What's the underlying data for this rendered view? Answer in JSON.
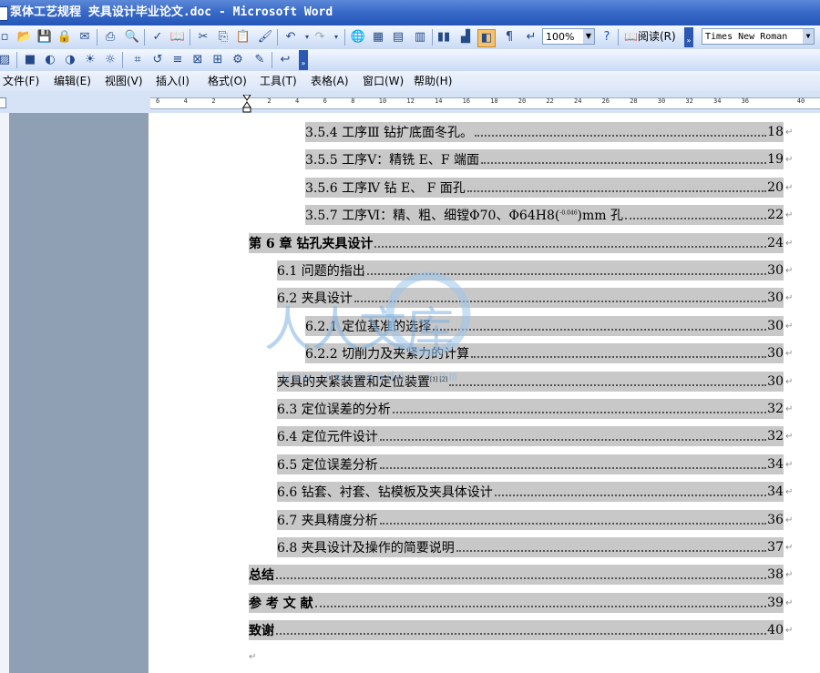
{
  "window": {
    "title": "泵体工艺规程 夹具设计毕业论文.doc - Microsoft Word"
  },
  "toolbar": {
    "zoom": "100%",
    "read_label": "阅读(R)",
    "font_name": "Times New Roman"
  },
  "menu": [
    {
      "label": "文件(F)"
    },
    {
      "label": "编辑(E)"
    },
    {
      "label": "视图(V)"
    },
    {
      "label": "插入(I)"
    },
    {
      "label": "格式(O)"
    },
    {
      "label": "工具(T)"
    },
    {
      "label": "表格(A)"
    },
    {
      "label": "窗口(W)"
    },
    {
      "label": "帮助(H)"
    }
  ],
  "ruler": {
    "labels": [
      "6",
      "4",
      "2",
      "",
      "2",
      "4",
      "6",
      "8",
      "10",
      "12",
      "14",
      "16",
      "18",
      "20",
      "22",
      "24",
      "26",
      "28",
      "30",
      "32",
      "34",
      "36",
      "",
      "40"
    ]
  },
  "watermark": {
    "text": "人人文库",
    "url": "www.renrendoc.com"
  },
  "toc": [
    {
      "text": "3.5.4 工序Ⅲ   钻扩底面冬孔。",
      "page": "18"
    },
    {
      "text": "3.5.5   工序Ⅴ：精铣 E、F 端面",
      "page": "19"
    },
    {
      "text": "3.5.6   工序Ⅳ 钻 E、  F 面孔",
      "page": "20"
    },
    {
      "text": "3.5.7 工序Ⅵ：精、粗、细镗Φ70、Φ64H8(",
      "formula": "-0.046",
      "tail": ")mm 孔",
      "page": "22"
    },
    {
      "text": "第 6 章  钻孔夹具设计",
      "page": "24"
    },
    {
      "text": "6.1  问题的指出",
      "page": "30"
    },
    {
      "text": "6.2  夹具设计",
      "page": "30"
    },
    {
      "text": "6.2.1  定位基准的选择",
      "page": "30"
    },
    {
      "text": "6.2.2  切削力及夹紧力的计算",
      "page": "30"
    },
    {
      "text": "夹具的夹紧装置和定位装置",
      "cite": "[1] [2]",
      "page": "30"
    },
    {
      "text": "6.3  定位误差的分析",
      "page": "32"
    },
    {
      "text": "6.4  定位元件设计",
      "page": "32"
    },
    {
      "text": "6.5  定位误差分析",
      "page": "34"
    },
    {
      "text": "6.6  钻套、衬套、钻模板及夹具体设计",
      "page": "34"
    },
    {
      "text": "6.7  夹具精度分析",
      "page": "36"
    },
    {
      "text": "6.8  夹具设计及操作的简要说明",
      "page": "37"
    },
    {
      "text": "总结",
      "page": "38"
    },
    {
      "text": "参 考 文 献",
      "page": "39"
    },
    {
      "text": "致谢",
      "page": "40"
    }
  ],
  "colors": {
    "titlebar": "#2456b8",
    "highlight": "#c8c8c8",
    "margin": "#8fa0b5"
  }
}
